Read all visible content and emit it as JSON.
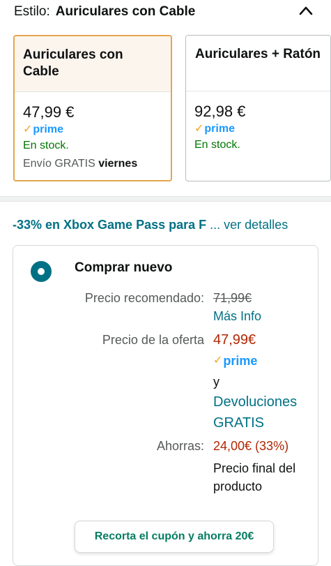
{
  "style": {
    "label": "Estilo:",
    "value": "Auriculares con Cable"
  },
  "variants": [
    {
      "title": "Auriculares con Cable",
      "price": "47,99 €",
      "prime": "prime",
      "stock": "En stock.",
      "shipping": "Envío GRATIS",
      "shipping_day": "viernes"
    },
    {
      "title": "Auriculares + Ratón",
      "price": "92,98 €",
      "prime": "prime",
      "stock": "En stock."
    }
  ],
  "promo": {
    "title": "-33% en Xbox Game Pass para F",
    "details": "... ver detalles"
  },
  "offer": {
    "heading": "Comprar nuevo",
    "list_price_label": "Precio recomendado:",
    "list_price": "71,99€",
    "more_info": "Más Info",
    "deal_price_label": "Precio de la oferta",
    "deal_price": "47,99€",
    "prime": "prime",
    "and": "y",
    "returns_line1": "Devoluciones",
    "returns_line2": "GRATIS",
    "savings_label": "Ahorras:",
    "savings": "24,00€ (33%)",
    "final_line1": "Precio final del",
    "final_line2": "producto",
    "coupon": "Recorta el cupón y ahorra 20€"
  },
  "colors": {
    "accent": "#007185",
    "price_red": "#b12704",
    "stock_green": "#007600",
    "selected_border": "#e4a54d"
  }
}
